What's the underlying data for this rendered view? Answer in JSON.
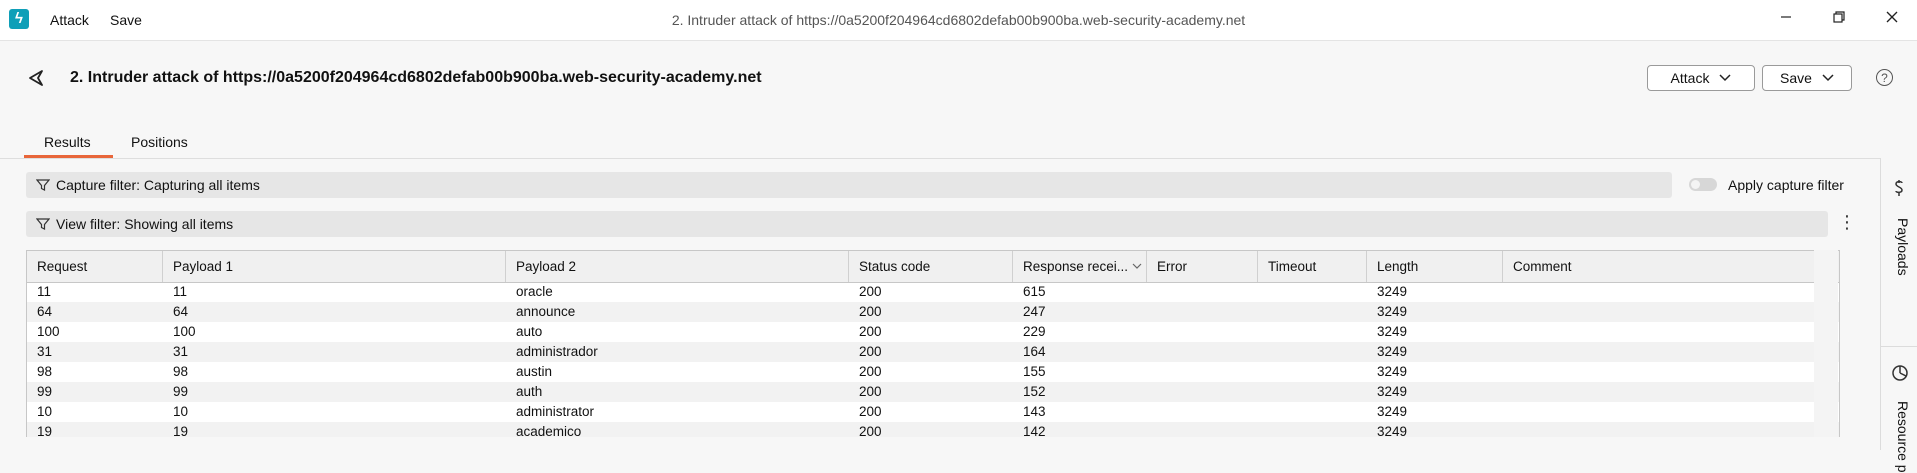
{
  "titlebar": {
    "logo_glyph": "ϟ",
    "menu": [
      "Attack",
      "Save"
    ],
    "title": "2. Intruder attack of https://0a5200f204964cd6802defab00b900ba.web-security-academy.net",
    "controls": [
      "minimize-icon",
      "restore-icon",
      "close-icon"
    ]
  },
  "header": {
    "title": "2. Intruder attack of https://0a5200f204964cd6802defab00b900ba.web-security-academy.net",
    "attack_button": "Attack",
    "save_button": "Save",
    "help_glyph": "?"
  },
  "tabs": [
    {
      "label": "Results",
      "active": true
    },
    {
      "label": "Positions",
      "active": false
    }
  ],
  "filters": {
    "capture": "Capture filter: Capturing all items",
    "view": "View filter: Showing all items",
    "apply_capture_label": "Apply capture filter",
    "apply_capture_on": false
  },
  "table": {
    "columns": [
      "Request",
      "Payload 1",
      "Payload 2",
      "Status code",
      "Response recei...",
      "Error",
      "Timeout",
      "Length",
      "Comment"
    ],
    "sorted_column": "Response recei...",
    "rows": [
      [
        "11",
        "11",
        "oracle",
        "200",
        "615",
        "",
        "",
        "3249",
        ""
      ],
      [
        "64",
        "64",
        "announce",
        "200",
        "247",
        "",
        "",
        "3249",
        ""
      ],
      [
        "100",
        "100",
        "auto",
        "200",
        "229",
        "",
        "",
        "3249",
        ""
      ],
      [
        "31",
        "31",
        "administrador",
        "200",
        "164",
        "",
        "",
        "3249",
        ""
      ],
      [
        "98",
        "98",
        "austin",
        "200",
        "155",
        "",
        "",
        "3249",
        ""
      ],
      [
        "99",
        "99",
        "auth",
        "200",
        "152",
        "",
        "",
        "3249",
        ""
      ],
      [
        "10",
        "10",
        "administrator",
        "200",
        "143",
        "",
        "",
        "3249",
        ""
      ],
      [
        "19",
        "19",
        "academico",
        "200",
        "142",
        "",
        "",
        "3249",
        ""
      ]
    ]
  },
  "side_panel": {
    "payloads_label": "Payloads",
    "resource_label": "Resource p"
  },
  "colors": {
    "accent": "#e8663a",
    "logo": "#0f9fb8"
  }
}
